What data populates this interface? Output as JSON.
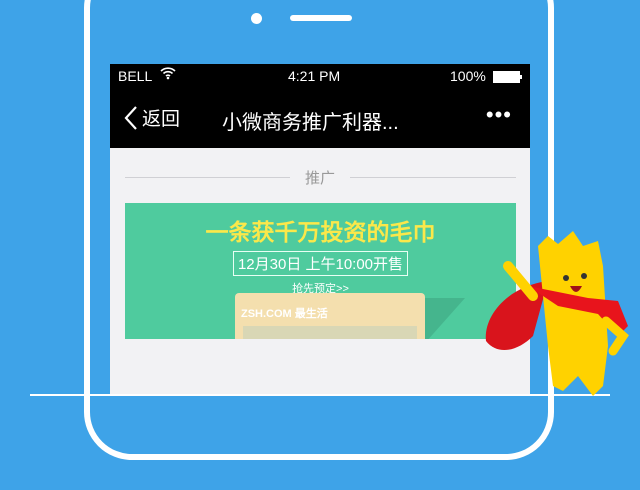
{
  "status": {
    "carrier": "BELL",
    "time": "4:21 PM",
    "battery": "100%"
  },
  "nav": {
    "back": "返回",
    "title": "小微商务推广利器...",
    "more": "•••"
  },
  "section": {
    "label": "推广"
  },
  "banner": {
    "headline": "一条获千万投资的毛巾",
    "date": "12月30日 上午10:00开售",
    "cta": "抢先预定>>",
    "brand": "ZSH.COM 最生活"
  }
}
